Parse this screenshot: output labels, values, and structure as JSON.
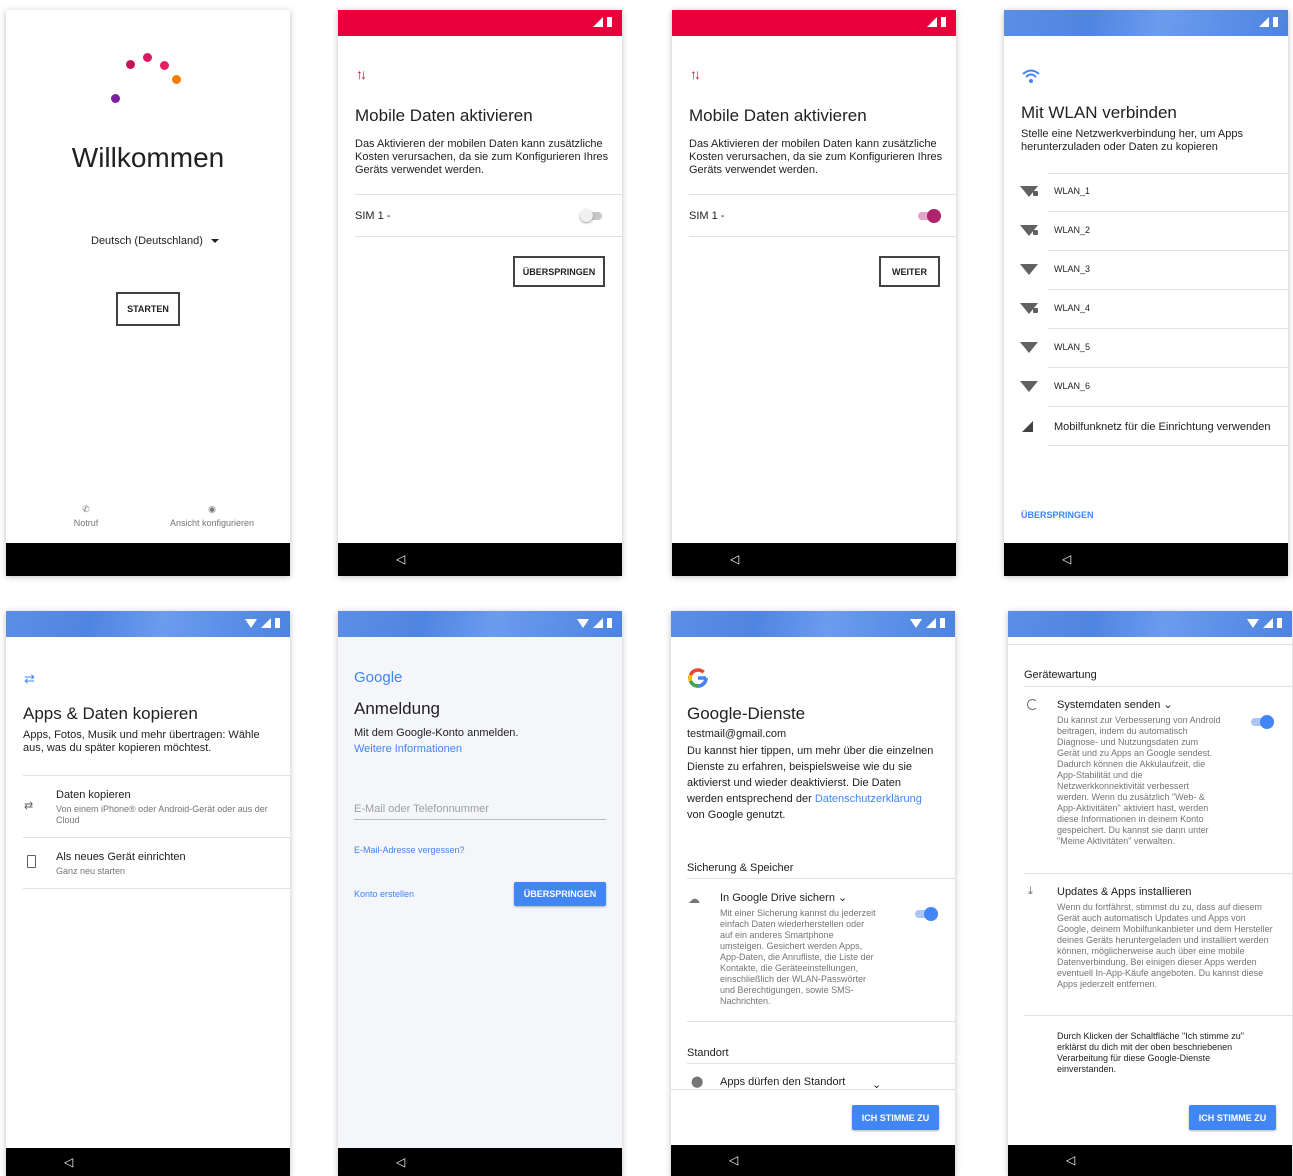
{
  "colors": {
    "red": "#e8003d",
    "magenta": "#b0226b",
    "blue": "#4285f4"
  },
  "s1": {
    "title": "Willkommen",
    "language": "Deutsch (Deutschland)",
    "start_button": "STARTEN",
    "emergency_label": "Notruf",
    "view_label": "Ansicht konfigurieren"
  },
  "s2": {
    "title": "Mobile Daten aktivieren",
    "body": "Das Aktivieren der mobilen Daten kann zusätzliche Kosten verursachen, da sie zum Konfigurieren Ihres Geräts verwendet werden.",
    "sim_label": "SIM 1 -",
    "toggle_state": "off",
    "skip_button": "ÜBERSPRINGEN"
  },
  "s3": {
    "title": "Mobile Daten aktivieren",
    "body": "Das Aktivieren der mobilen Daten kann zusätzliche Kosten verursachen, da sie zum Konfigurieren Ihres Geräts verwendet werden.",
    "sim_label": "SIM 1 -",
    "toggle_state": "on",
    "next_button": "WEITER"
  },
  "s4": {
    "title": "Mit WLAN verbinden",
    "body": "Stelle eine Netzwerkverbindung her, um Apps herunterzuladen oder Daten zu kopieren",
    "networks": [
      {
        "name": "WLAN_1",
        "locked": true
      },
      {
        "name": "WLAN_2",
        "locked": true
      },
      {
        "name": "WLAN_3",
        "locked": false
      },
      {
        "name": "WLAN_4",
        "locked": true
      },
      {
        "name": "WLAN_5",
        "locked": false
      },
      {
        "name": "WLAN_6",
        "locked": false
      }
    ],
    "mobile_option": "Mobilfunknetz für die Einrichtung verwenden",
    "skip_link": "ÜBERSPRINGEN"
  },
  "s5": {
    "title": "Apps & Daten kopieren",
    "body": "Apps, Fotos, Musik und mehr übertragen: Wähle aus, was du später kopieren möchtest.",
    "options": [
      {
        "title": "Daten kopieren",
        "subtitle": "Von einem iPhone® oder Android-Gerät oder aus der Cloud"
      },
      {
        "title": "Als neues Gerät einrichten",
        "subtitle": "Ganz neu starten"
      }
    ]
  },
  "s6": {
    "logo": "Google",
    "title": "Anmeldung",
    "body": "Mit dem Google-Konto anmelden.",
    "more_info": "Weitere Informationen",
    "email_placeholder": "E-Mail oder Telefonnummer",
    "forgot_link": "E-Mail-Adresse vergessen?",
    "create_link": "Konto erstellen",
    "skip_button": "ÜBERSPRINGEN"
  },
  "s7": {
    "title": "Google-Dienste",
    "account": "testmail@gmail.com",
    "body_pre": "Du kannst hier tippen, um mehr über die einzelnen Dienste zu erfahren, beispielsweise wie du sie aktivierst und wieder deaktivierst. Die Daten werden entsprechend der ",
    "privacy_link": "Datenschutzerklärung",
    "body_post": " von Google genutzt.",
    "section_backup": "Sicherung & Speicher",
    "backup_title": "In Google Drive sichern",
    "backup_body": "Mit einer Sicherung kannst du jederzeit einfach Daten wiederherstellen oder auf ein anderes Smartphone umsteigen. Gesichert werden Apps, App-Daten, die Anrufliste, die Liste der Kontakte, die Geräteeinstellungen, einschließlich der WLAN-Passwörter und Berechtigungen, sowie SMS-Nachrichten.",
    "section_location": "Standort",
    "location_title": "Apps dürfen den Standort",
    "accept_button": "ICH STIMME ZU"
  },
  "s8": {
    "section": "Gerätewartung",
    "sys_title": "Systemdaten senden",
    "sys_body": "Du kannst zur Verbesserung von Android beitragen, indem du automatisch Diagnose- und Nutzungsdaten zum Gerät und zu Apps an Google sendest. Dadurch können die Akkulaufzeit, die App-Stabilität und die Netzwerkkonnektivität verbessert werden. Wenn du zusätzlich \"Web- & App-Aktivitäten\" aktiviert hast, werden diese Informationen in deinem Konto gespeichert. Du kannst sie dann unter \"Meine Aktivitäten\" verwalten.",
    "upd_title": "Updates & Apps installieren",
    "upd_body": "Wenn du fortfährst, stimmst du zu, dass auf diesem Gerät auch automatisch Updates und Apps von Google, deinem Mobilfunkanbieter und dem Hersteller deines Geräts heruntergeladen und installiert werden können, möglicherweise auch über eine mobile Datenverbindung. Bei einigen dieser Apps werden eventuell In-App-Käufe angeboten. Du kannst diese Apps jederzeit entfernen.",
    "consent": "Durch Klicken der Schaltfläche \"Ich stimme zu\" erklärst du dich mit der oben beschriebenen Verarbeitung für diese Google-Dienste einverstanden.",
    "accept_button": "ICH STIMME ZU"
  }
}
